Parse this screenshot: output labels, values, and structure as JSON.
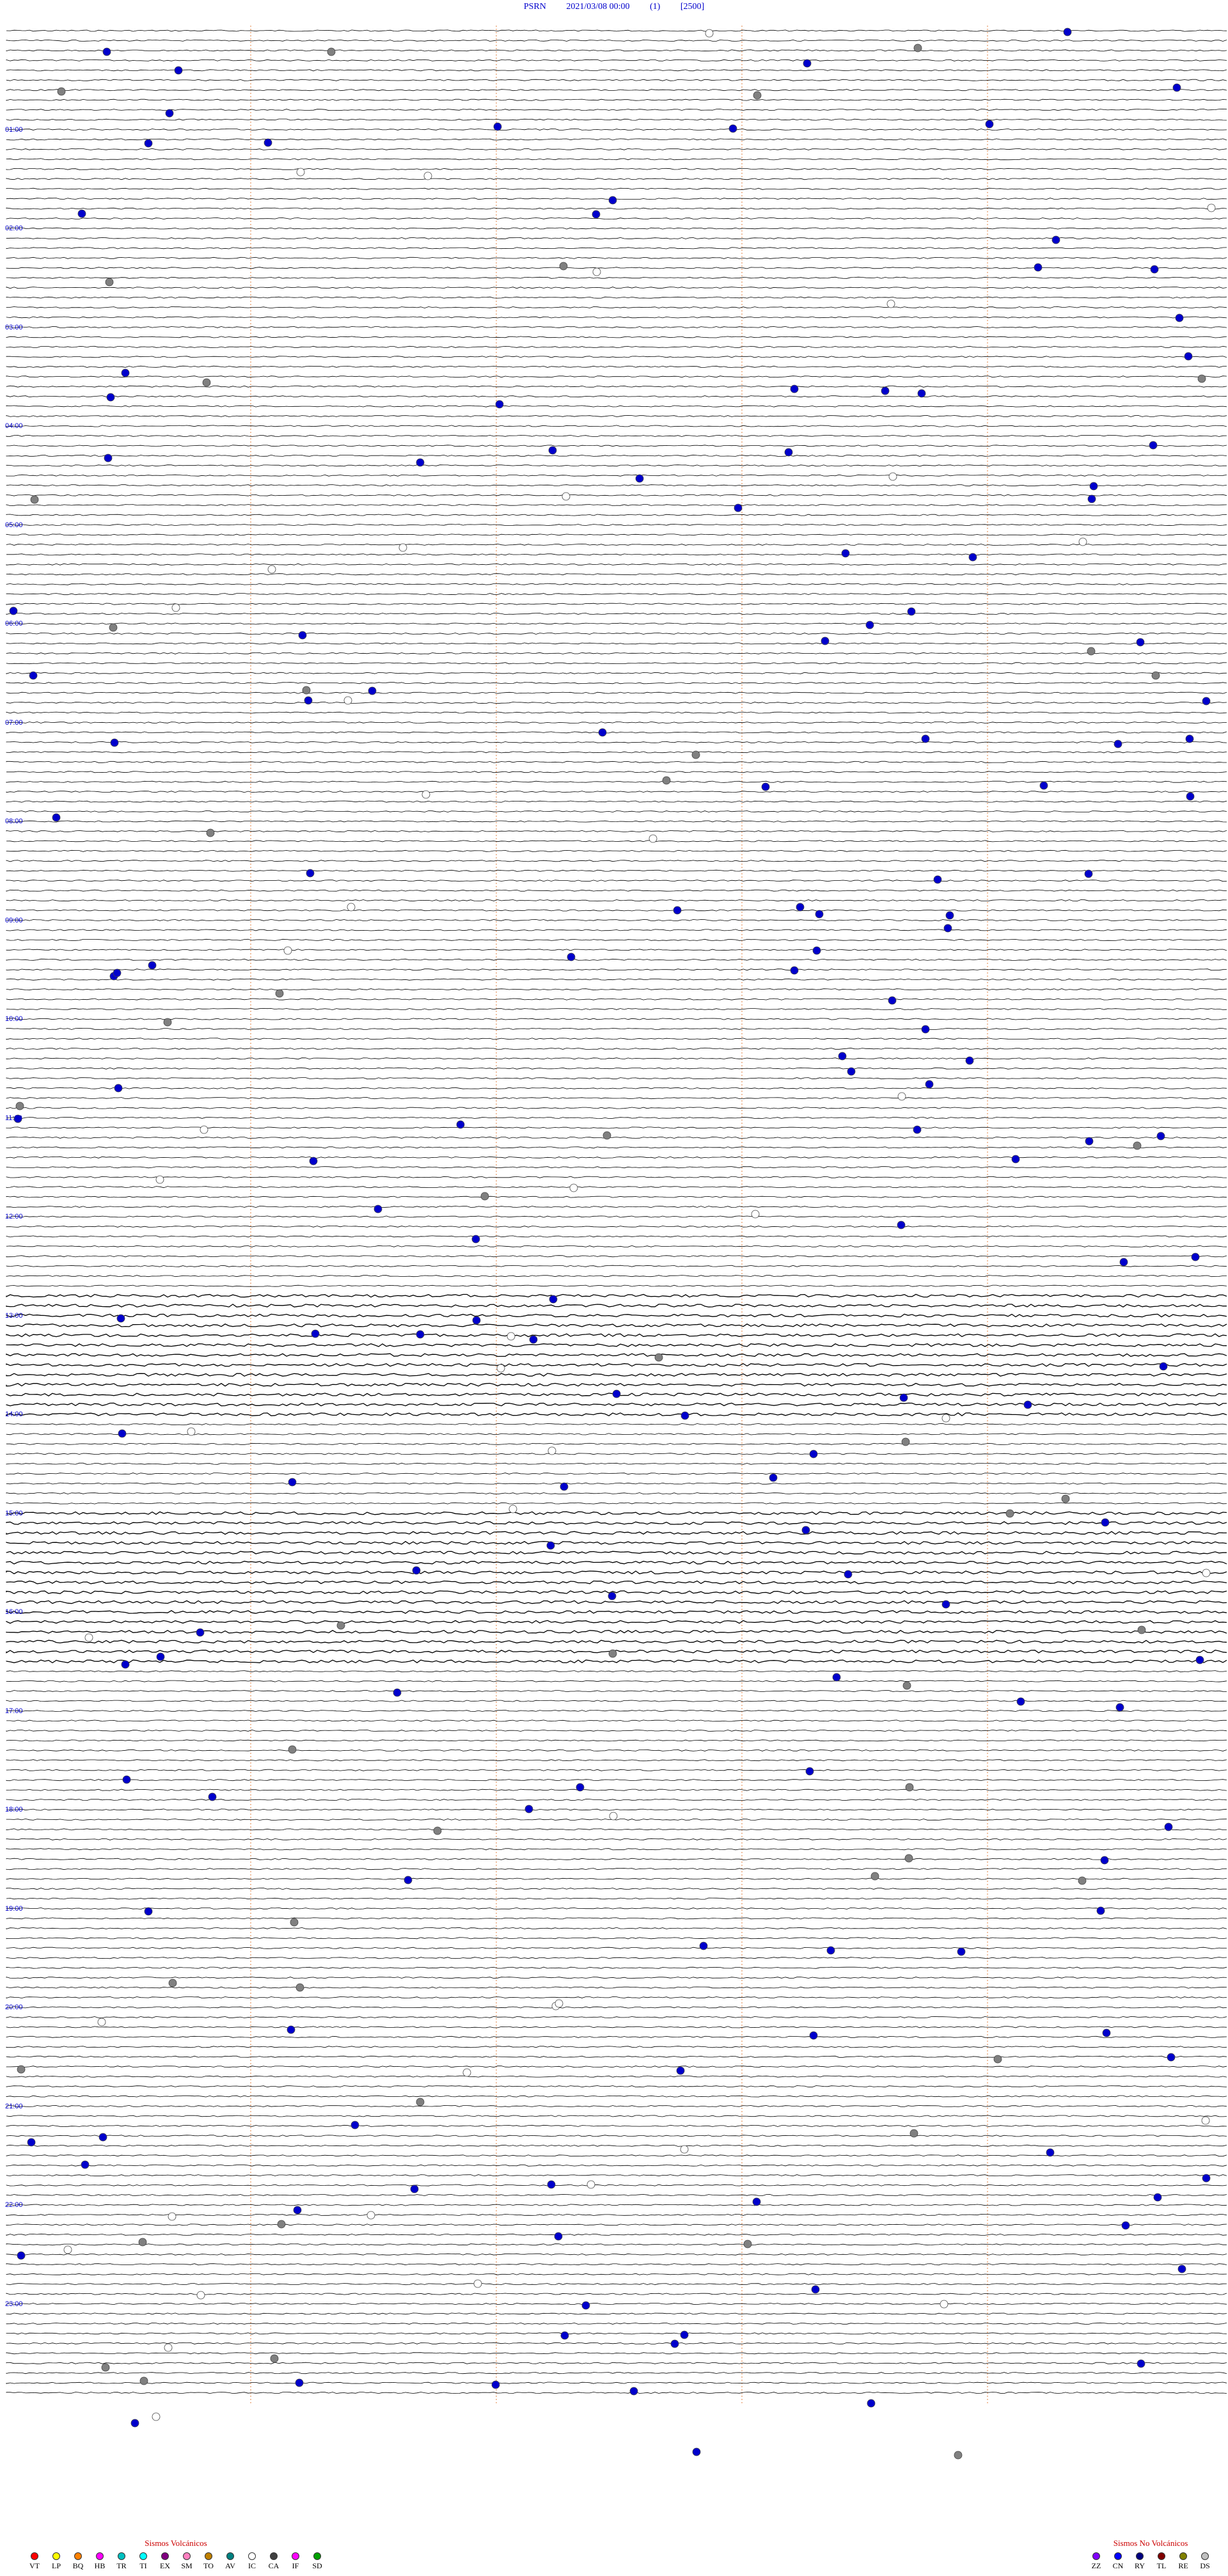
{
  "header": {
    "station": "PSRN",
    "datetime": "2021/03/08 00:00",
    "scale": "(1)",
    "gain": "[2500]"
  },
  "hour_labels": [
    "01:00",
    "02:00",
    "03:00",
    "04:00",
    "05:00",
    "06:00",
    "07:00",
    "08:00",
    "09:00",
    "10:00",
    "11:00",
    "12:00",
    "13:00",
    "14:00",
    "15:00",
    "16:00",
    "17:00",
    "18:00",
    "19:00",
    "20:00",
    "21:00",
    "22:00",
    "23:00"
  ],
  "legend_volcanic": {
    "title": "Sismos Volcánicos",
    "items": [
      {
        "code": "VT",
        "color": "#ff0000"
      },
      {
        "code": "LP",
        "color": "#ffff00"
      },
      {
        "code": "BQ",
        "color": "#ff8000"
      },
      {
        "code": "HB",
        "color": "#ff00ff"
      },
      {
        "code": "TR",
        "color": "#00c0c0"
      },
      {
        "code": "TI",
        "color": "#00ffff"
      },
      {
        "code": "EX",
        "color": "#800080"
      },
      {
        "code": "SM",
        "color": "#ff80c0"
      },
      {
        "code": "TO",
        "color": "#c08000"
      },
      {
        "code": "AV",
        "color": "#008080"
      },
      {
        "code": "IC",
        "color": "#ffffff"
      },
      {
        "code": "CA",
        "color": "#404040"
      },
      {
        "code": "IF",
        "color": "#ff00ff"
      },
      {
        "code": "SD",
        "color": "#00a000"
      }
    ]
  },
  "legend_nonvolcanic": {
    "title": "Sismos No Volcánicos",
    "items": [
      {
        "code": "ZZ",
        "color": "#8000ff"
      },
      {
        "code": "CN",
        "color": "#0000ff"
      },
      {
        "code": "RY",
        "color": "#000080"
      },
      {
        "code": "TL",
        "color": "#800000"
      },
      {
        "code": "RE",
        "color": "#808000"
      },
      {
        "code": "DS",
        "color": "#c0c0c0"
      }
    ]
  },
  "colors": {
    "trace": "#000000",
    "title": "#0000cc",
    "minute_marker": "#e08040",
    "marker_blue": "#0000cc",
    "marker_gray": "#808080",
    "marker_white": "#ffffff"
  }
}
